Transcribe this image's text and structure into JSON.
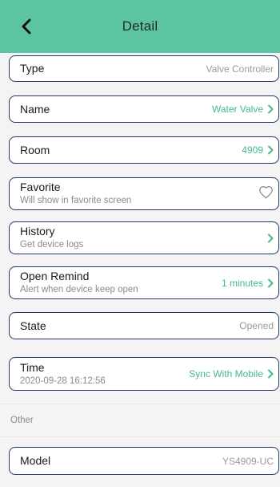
{
  "header": {
    "title": "Detail"
  },
  "rows": [
    {
      "label": "Type",
      "sub": "",
      "value": "Valve Controller"
    },
    {
      "label": "Name",
      "sub": "",
      "value": "Water Valve"
    },
    {
      "label": "Room",
      "sub": "",
      "value": "4909"
    },
    {
      "label": "Favorite",
      "sub": "Will show in favorite screen",
      "value": ""
    },
    {
      "label": "History",
      "sub": "Get device logs",
      "value": ""
    },
    {
      "label": "Open Remind",
      "sub": "Alert when device keep open",
      "value": "1 minutes"
    },
    {
      "label": "State",
      "sub": "",
      "value": "Opened"
    },
    {
      "label": "Time",
      "sub": "2020-09-28 16:12:56",
      "value": "Sync With Mobile"
    }
  ],
  "section_other": "Other",
  "model": {
    "label": "Model",
    "value": "YS4909-UC"
  },
  "colors": {
    "header": "#5cc4a0",
    "accent": "#45b893",
    "border": "#1f3a66"
  },
  "icons": {
    "back": "chevron-left-icon",
    "forward": "chevron-right-icon",
    "favorite": "heart-outline-icon"
  }
}
